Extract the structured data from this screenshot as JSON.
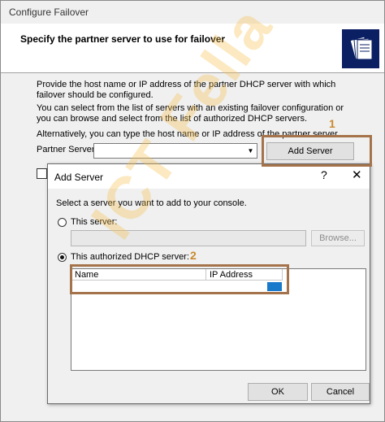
{
  "outer": {
    "title": "Configure Failover",
    "heading": "Specify the partner server to use for failover",
    "para1": "Provide the host name or IP address of the partner DHCP server with which failover should be configured.",
    "para2": "You can select from the list of servers with an existing failover configuration or you can browse and select from the list of authorized DHCP servers.",
    "para3": "Alternatively, you can type the host name or IP address of the partner server.",
    "partner_label": "Partner Server:",
    "partner_value": "",
    "add_server_label": "Add Server"
  },
  "dialog": {
    "title": "Add Server",
    "help": "?",
    "close": "✕",
    "instruction": "Select a server you want to add to your console.",
    "this_server_label": "This server:",
    "this_server_value": "",
    "browse_label": "Browse...",
    "authorized_label": "This authorized DHCP server:",
    "columns": [
      "Name",
      "IP Address"
    ],
    "ok_label": "OK",
    "cancel_label": "Cancel"
  },
  "annotations": {
    "n1": "1",
    "n2": "2"
  },
  "watermark": "ICT Fella",
  "colors": {
    "annotation": "#a5734b",
    "selection": "#1979ca",
    "header_icon": "#0b1f63"
  }
}
